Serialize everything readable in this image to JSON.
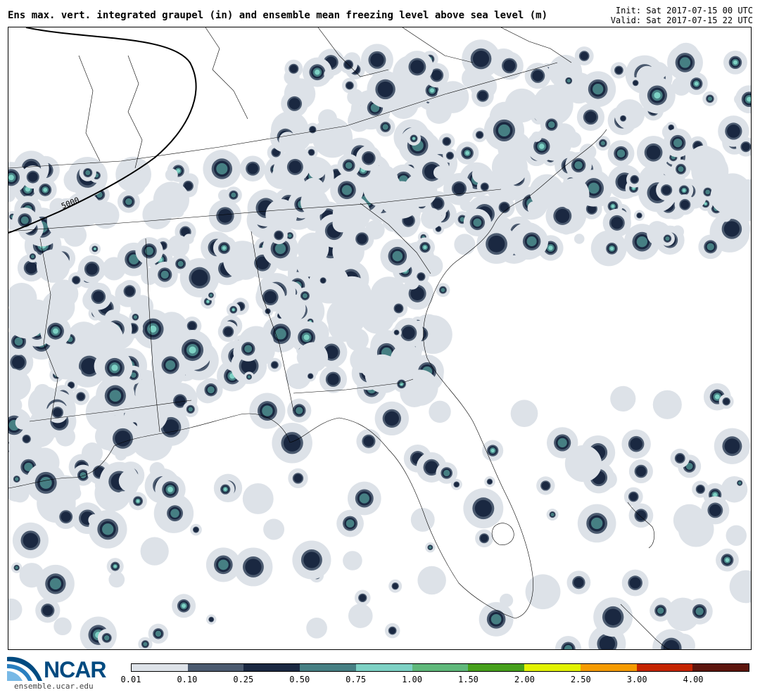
{
  "header": {
    "title": "Ens max. vert. integrated graupel (in) and ensemble mean freezing level above sea level (m)",
    "init": "Init: Sat 2017-07-15 00 UTC",
    "valid": "Valid: Sat 2017-07-15 22 UTC"
  },
  "map": {
    "region": "Southeastern United States",
    "contour_label": "5000",
    "colors": {
      "land_outline": "#000000",
      "contour": "#000000",
      "background": "#ffffff"
    }
  },
  "legend": {
    "colors": [
      "#dde2e8",
      "#4b5a6f",
      "#1a2841",
      "#467f83",
      "#7dd1c4",
      "#5fb87a",
      "#46a01c",
      "#e2f200",
      "#f59b00",
      "#c52500",
      "#5c150d"
    ],
    "ticks": [
      "0.01",
      "0.10",
      "0.25",
      "0.50",
      "0.75",
      "1.00",
      "1.50",
      "2.00",
      "2.50",
      "3.00",
      "4.00"
    ]
  },
  "branding": {
    "logo_text": "NCAR",
    "url": "ensemble.ucar.edu",
    "logo_icon": "ncar-swoosh-icon"
  }
}
